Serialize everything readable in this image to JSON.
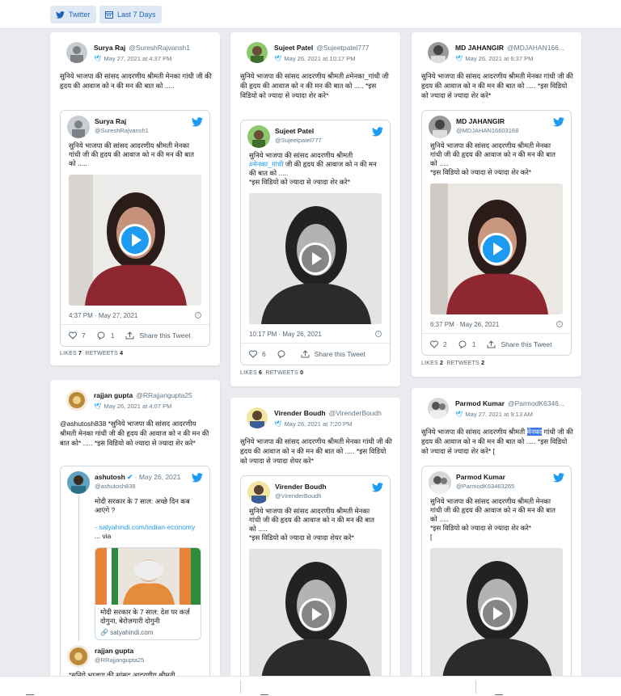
{
  "toolbar": {
    "twitter_label": "Twitter",
    "range_label": "Last 7 Days"
  },
  "colors": {
    "twitter_blue": "#1d9bf0",
    "chip_bg": "#dfe9f6",
    "highlight": "#3b76e8"
  },
  "posts": [
    {
      "name": "Surya Raj",
      "handle": "@SureshRajvansh1",
      "date": "May 27, 2021 at 4:37 PM",
      "text": "सुनिये भाजपा की सांसद आदरणीय श्रीमती मेनका गांधी जी की हृदय की आवाज को न की मन की बात को .....",
      "embed": {
        "name": "Surya Raj",
        "handle": "@SureshRajvansh1",
        "text": "सुनिये भाजपा की सांसद आदरणीय श्रीमती मेनका गांधी जी की हृदय की आवाज को न की मन की बात को .....",
        "time": "4:37 PM · May 27, 2021",
        "likes": "7",
        "replies": "1",
        "share": "Share this Tweet"
      },
      "likes_label": "LIKES",
      "likes": "7",
      "retweets_label": "RETWEETS",
      "retweets": "4"
    },
    {
      "name": "Sujeet Patel",
      "handle": "@Sujeetpatel777",
      "date": "May 26, 2021 at 10:17 PM",
      "text": "सुनिये भाजपा की सांसद आदरणीय श्रीमती #मेनका_गांधी जी की हृदय की आवाज को न की मन की बात को ..... *इस विडियो को ज्यादा से ज्यादा शेर करे*",
      "embed": {
        "name": "Sujeet Patel",
        "handle": "@Sujeetpatel777",
        "text_a": "सुनिये भाजपा की सांसद आदरणीय श्रीमती",
        "tag": "#मेनका_गांधी",
        "text_b": "जी की हृदय की आवाज को न की मन की बात को .....",
        "text_c": "*इस विडियो को ज्यादा से ज्यादा शेर करे*",
        "time": "10:17 PM · May 26, 2021",
        "likes": "6",
        "replies": "",
        "share": "Share this Tweet"
      },
      "likes_label": "LIKES",
      "likes": "6",
      "retweets_label": "RETWEETS",
      "retweets": "0"
    },
    {
      "name": "MD JAHANGIR",
      "handle": "@MDJAHAN166...",
      "date": "May 26, 2021 at 6:37 PM",
      "text": "सुनिये भाजपा की सांसद आदरणीय श्रीमती मेनका गांधी जी की हृदय की आवाज को न की मन की बात को ..... *इस विडियो को ज्यादा से ज्यादा शेर करे*",
      "embed": {
        "name": "MD JAHANGIR",
        "handle": "@MDJAHAN16603168",
        "text_a": "सुनिये भाजपा की सांसद आदरणीय श्रीमती मेनका गांधी जी की हृदय की आवाज को न की मन की बात को .....",
        "text_c": "*इस विडियो को ज्यादा से ज्यादा शेर करे*",
        "time": "6:37 PM · May 26, 2021",
        "likes": "2",
        "replies": "1",
        "share": "Share this Tweet"
      },
      "likes_label": "LIKES",
      "likes": "2",
      "retweets_label": "RETWEETS",
      "retweets": "2"
    },
    {
      "name": "rajjan gupta",
      "handle": "@RRajjangupta25",
      "date": "May 26, 2021 at 4:07 PM",
      "text": "@ashutosh838 *सुनिये भाजपा की सांसद आदरणीय श्रीमती मेनका गांधी जी की हृदय की आवाज को न की मन की बात को* ..... *इस विडियो को ज्यादा से ज्यादा शेर करे*",
      "embed": {
        "name": "ashutosh",
        "handle": "@ashutosh838",
        "date": "· May 26, 2021",
        "text": "मोदी सरकार के 7 साल: अच्छे दिन कब आएंगे ?",
        "link": "- satyahindi.com/indian-economy",
        "via": "... via",
        "news_title": "मोदी सरकार के 7 साल: देश पर कर्ज़ दोगुना, बेरोज़गारी दोगुनी",
        "news_url": "satyahindi.com",
        "reply_name": "rajjan gupta",
        "reply_handle": "@RRajjangupta25",
        "reply_text": "*सुनिये भाजपा की सांसद आदरणीय श्रीमती"
      }
    },
    {
      "name": "Virender Boudh",
      "handle": "@VirenderBoudh",
      "date": "May 26, 2021 at 7:20 PM",
      "text": "सुनिये भाजपा की सांसद आदरणीय श्रीमती मेनका गांधी जी की हृदय की आवाज को न की मन की बात को ..... *इस विडियो को ज्यादा से ज्यादा शेयर करे*",
      "embed": {
        "name": "Virender Boudh",
        "handle": "@VirenderBoudh",
        "text_a": "सुनिये भाजपा की सांसद आदरणीय श्रीमती मेनका गांधी जी की हृदय की आवाज को न की मन की बात को .....",
        "text_c": "*इस विडियो को ज्यादा से ज्यादा शेयर करे*"
      }
    },
    {
      "name": "Parmod Kumar",
      "handle": "@ParmodK6346...",
      "date": "May 27, 2021 at 9:13 AM",
      "text_a": "सुनिये भाजपा की सांसद आदरणीय श्रीमती",
      "text_hl": "मेनका",
      "text_b": "गांधी जी की हृदय की आवाज को न की मन की बात को ..... *इस विडियो को ज्यादा से ज्यादा शेर करे* [",
      "embed": {
        "name": "Parmod Kumar",
        "handle": "@ParmodK63463265",
        "text_a": "सुनिये भाजपा की सांसद आदरणीय श्रीमती मेनका गांधी जी की हृदय की आवाज को न की मन की बात को .....",
        "text_c": "*इस विडियो को ज्यादा से ज्यादा शेर करे*",
        "text_d": "["
      }
    }
  ]
}
